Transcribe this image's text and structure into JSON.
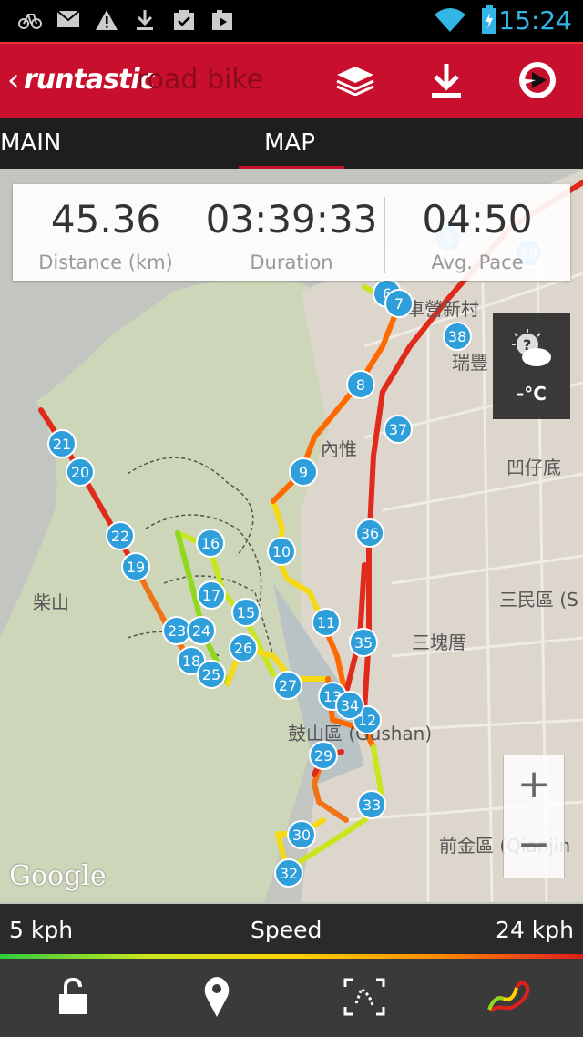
{
  "status_bar": {
    "icons": [
      "bike-notification-icon",
      "mail-icon",
      "warning-icon",
      "download-icon",
      "clipboard-check-icon",
      "media-icon"
    ],
    "wifi": "wifi-icon",
    "battery": "battery-charging-icon",
    "time": "15:24"
  },
  "app_bar": {
    "back": "‹",
    "brand": "runtastic",
    "product": "road bike",
    "actions": [
      "layers-icon",
      "download-icon",
      "share-icon"
    ]
  },
  "tabs": [
    {
      "label": "MAIN",
      "active": false
    },
    {
      "label": "MAP",
      "active": true
    }
  ],
  "stats": [
    {
      "value": "45.36",
      "label": "Distance (km)"
    },
    {
      "value": "03:39:33",
      "label": "Duration"
    },
    {
      "value": "04:50",
      "label": "Avg. Pace"
    }
  ],
  "weather": {
    "icon": "weather-unknown-icon",
    "temp": "-°C"
  },
  "map": {
    "labels": [
      "內惟",
      "凹仔底",
      "三民區 (S",
      "三塊厝",
      "柴山",
      "鼓山區 (Gushan)",
      "前金區 (Qianjin",
      "車營新村",
      "瑞豐"
    ],
    "markers": [
      "5",
      "6",
      "7",
      "8",
      "9",
      "10",
      "11",
      "12",
      "13",
      "15",
      "16",
      "17",
      "18",
      "19",
      "20",
      "21",
      "22",
      "23",
      "24",
      "25",
      "26",
      "27",
      "29",
      "30",
      "32",
      "33",
      "34",
      "35",
      "36",
      "37",
      "38",
      "39"
    ],
    "zoom_in": "+",
    "zoom_out": "−",
    "attribution": "Google"
  },
  "speed_legend": {
    "min": "5 kph",
    "title": "Speed",
    "max": "24 kph"
  },
  "bottom_bar": [
    "lock-icon",
    "location-pin-icon",
    "fit-route-icon",
    "route-colored-icon"
  ],
  "colors": {
    "brand_red": "#c8102e",
    "marker_blue": "#2f9fdc",
    "accent_blue": "#33b5e5"
  }
}
